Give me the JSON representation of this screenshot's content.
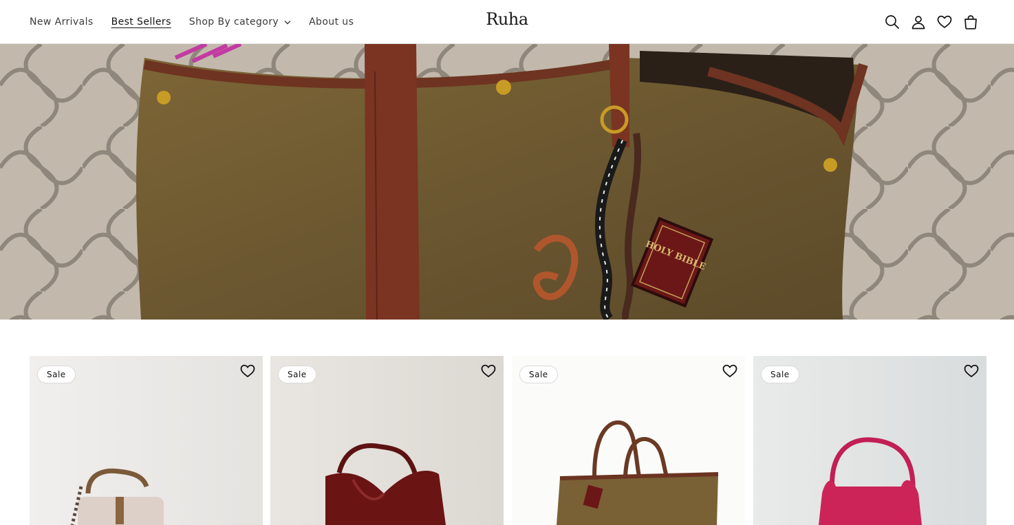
{
  "brand": {
    "logo_text": "Ruha"
  },
  "nav": {
    "items": [
      {
        "label": "New Arrivals"
      },
      {
        "label": "Best Sellers"
      },
      {
        "label": "Shop By category"
      },
      {
        "label": "About us"
      }
    ]
  },
  "header_icons": [
    "search-icon",
    "account-icon",
    "wishlist-icon",
    "cart-icon"
  ],
  "hero": {
    "keychain_tag_text": "HOLY BIBLE"
  },
  "products": [
    {
      "badge": "Sale"
    },
    {
      "badge": "Sale"
    },
    {
      "badge": "Sale"
    },
    {
      "badge": "Sale"
    }
  ],
  "colors": {
    "accent": "#121212",
    "nav_text": "#3a3a3a"
  }
}
